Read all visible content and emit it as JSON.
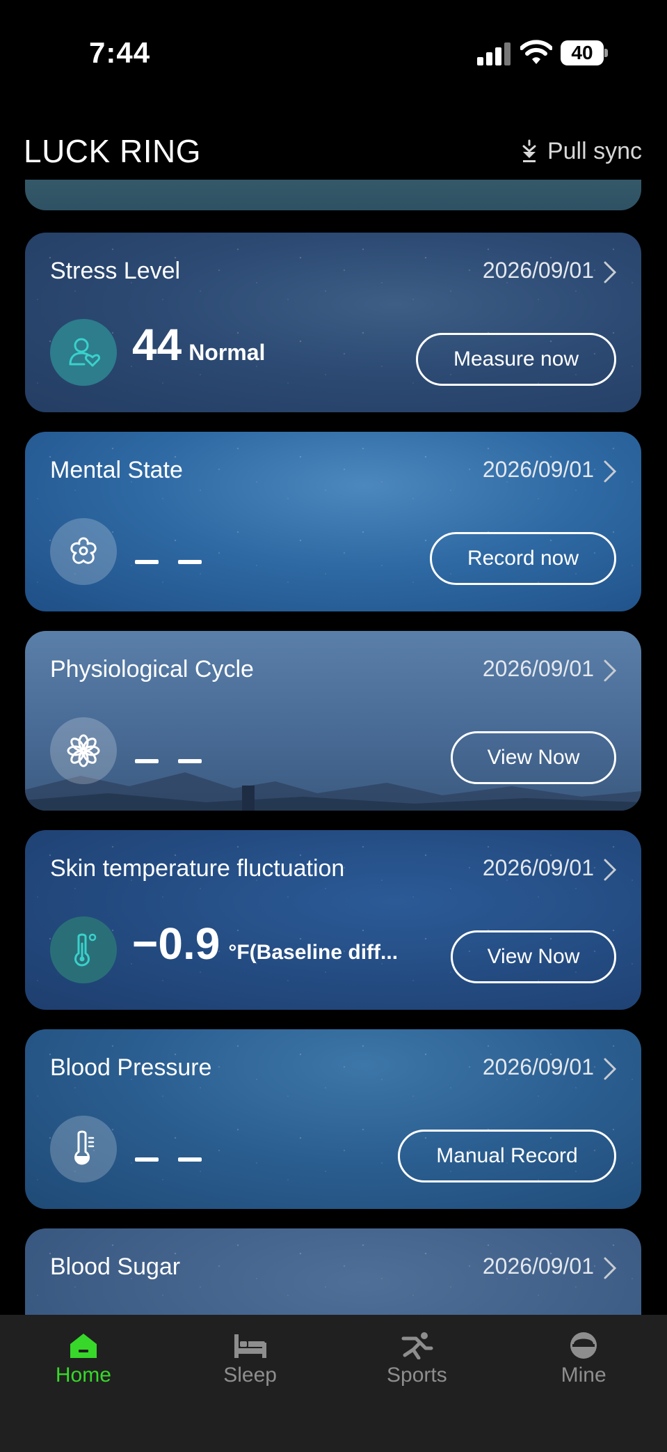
{
  "status_bar": {
    "time": "7:44",
    "battery": "40"
  },
  "header": {
    "title": "LUCK RING",
    "sync_label": "Pull sync"
  },
  "cards": [
    {
      "title": "Stress Level",
      "date": "2026/09/01",
      "value": "44",
      "status": "Normal",
      "action": "Measure now",
      "icon": "person-heart-icon"
    },
    {
      "title": "Mental State",
      "date": "2026/09/01",
      "value": "– –",
      "action": "Record now",
      "icon": "flower-icon"
    },
    {
      "title": "Physiological Cycle",
      "date": "2026/09/01",
      "value": "– –",
      "action": "View Now",
      "icon": "petal-flower-icon"
    },
    {
      "title": "Skin temperature fluctuation",
      "date": "2026/09/01",
      "value": "−0.9",
      "unit": "°F(Baseline diff...",
      "action": "View Now",
      "icon": "thermometer-icon"
    },
    {
      "title": "Blood Pressure",
      "date": "2026/09/01",
      "value": "– –",
      "action": "Manual Record",
      "icon": "thermometer-scale-icon"
    },
    {
      "title": "Blood Sugar",
      "date": "2026/09/01"
    }
  ],
  "nav": {
    "items": [
      {
        "label": "Home",
        "icon": "home-icon",
        "active": true
      },
      {
        "label": "Sleep",
        "icon": "bed-icon",
        "active": false
      },
      {
        "label": "Sports",
        "icon": "running-icon",
        "active": false
      },
      {
        "label": "Mine",
        "icon": "profile-icon",
        "active": false
      }
    ]
  },
  "colors": {
    "accent": "#37d82a",
    "nav_bg": "#202020",
    "teal_icon": "#3ad1cc"
  }
}
